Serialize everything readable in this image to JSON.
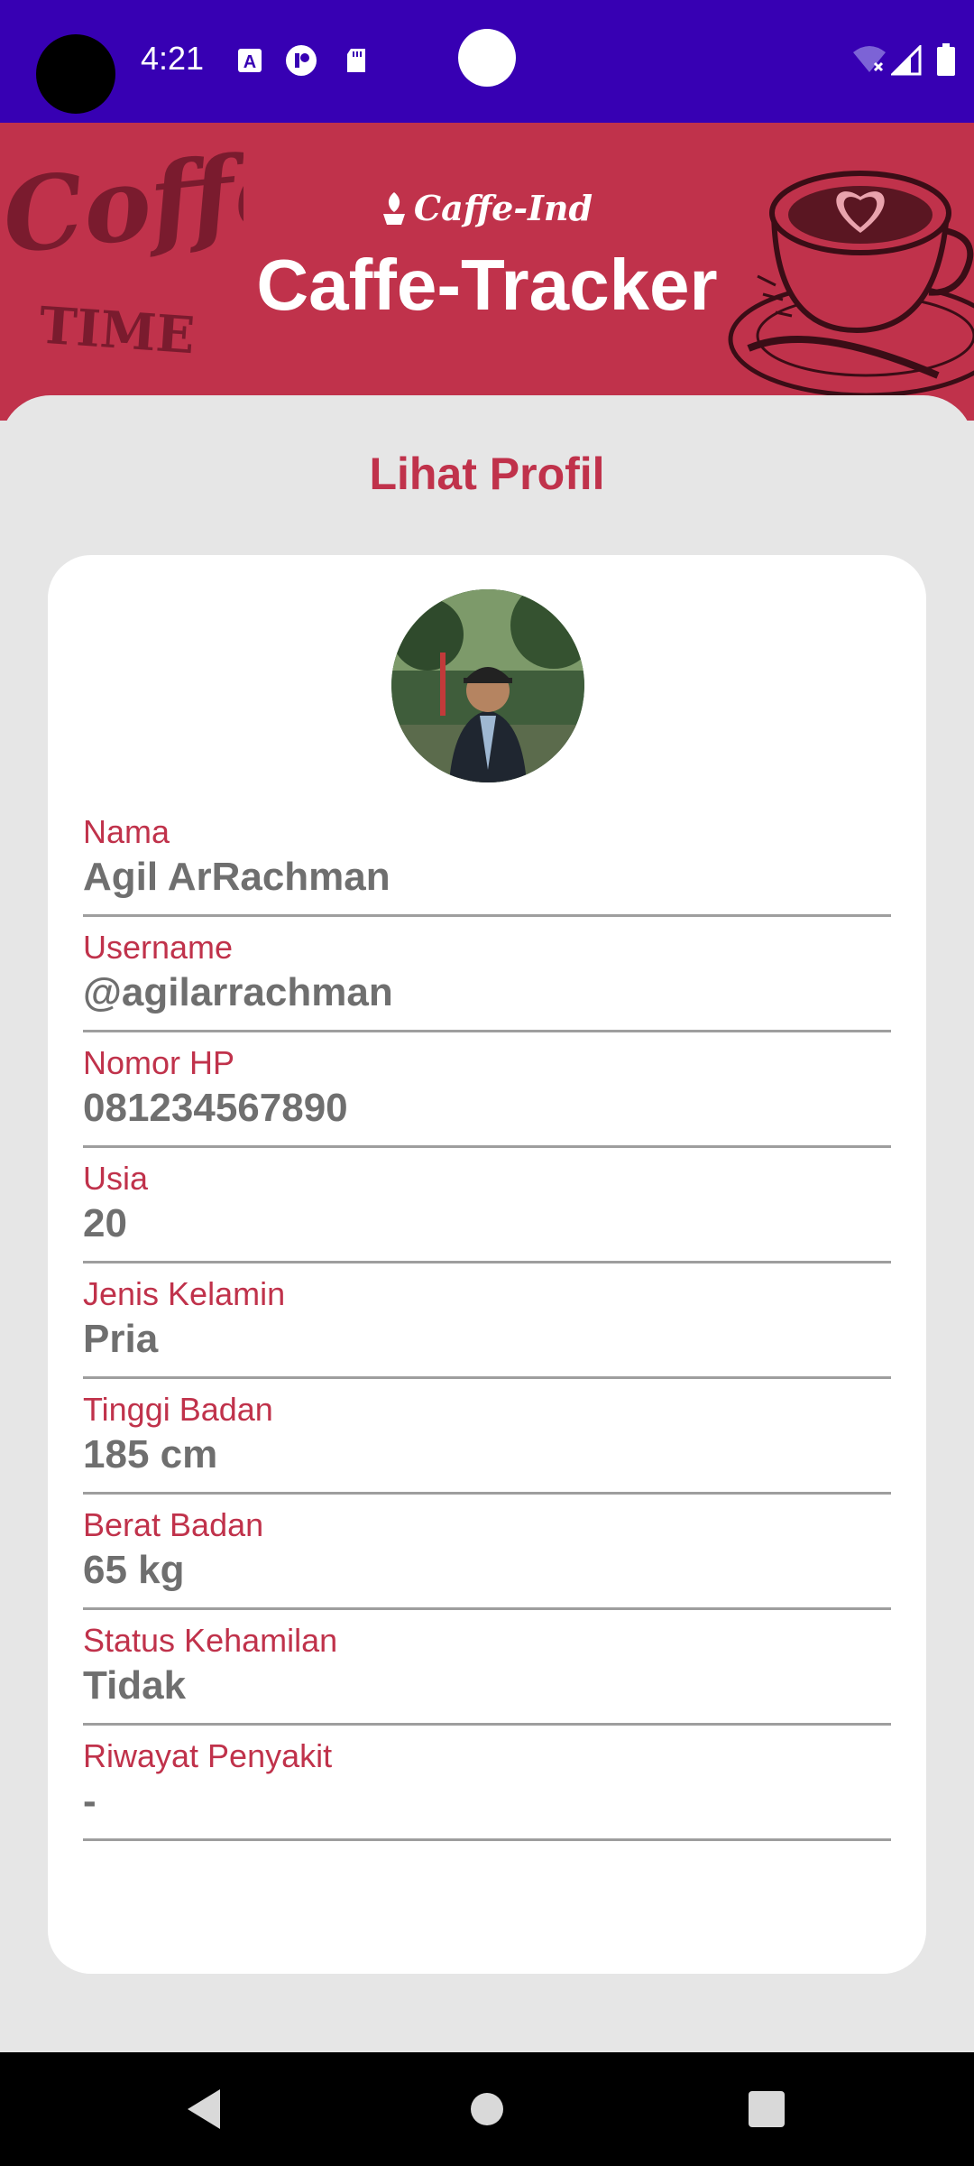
{
  "status_bar": {
    "time": "4:21",
    "left_icons": [
      "font-icon",
      "status-app-icon",
      "sd-card-icon"
    ],
    "right_icons": [
      "wifi-off-icon",
      "signal-icon",
      "battery-icon"
    ]
  },
  "header": {
    "brand": "Caffe-Ind",
    "title": "Caffe-Tracker",
    "decor_left_text": [
      "Coffee",
      "TIME"
    ]
  },
  "page": {
    "title": "Lihat Profil"
  },
  "profile": {
    "fields": [
      {
        "label": "Nama",
        "value": "Agil ArRachman"
      },
      {
        "label": "Username",
        "value": "@agilarrachman"
      },
      {
        "label": "Nomor HP",
        "value": "081234567890"
      },
      {
        "label": "Usia",
        "value": "20"
      },
      {
        "label": "Jenis Kelamin",
        "value": "Pria"
      },
      {
        "label": "Tinggi Badan",
        "value": "185 cm"
      },
      {
        "label": "Berat Badan",
        "value": "65 kg"
      },
      {
        "label": "Status Kehamilan",
        "value": "Tidak"
      },
      {
        "label": "Riwayat Penyakit",
        "value": "-"
      }
    ]
  },
  "nav": {
    "buttons": [
      "back-icon",
      "home-icon",
      "recents-icon"
    ]
  },
  "colors": {
    "status_bar": "#3700b3",
    "accent": "#c0324b",
    "value_text": "#6f6f6f",
    "background": "#e6e6e6"
  }
}
